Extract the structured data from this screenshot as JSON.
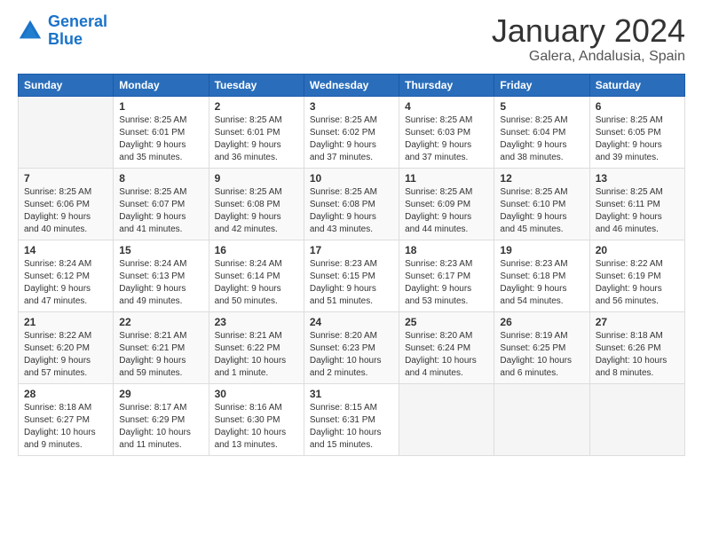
{
  "header": {
    "logo_line1": "General",
    "logo_line2": "Blue",
    "title": "January 2024",
    "subtitle": "Galera, Andalusia, Spain"
  },
  "days_of_week": [
    "Sunday",
    "Monday",
    "Tuesday",
    "Wednesday",
    "Thursday",
    "Friday",
    "Saturday"
  ],
  "weeks": [
    [
      {
        "day": "",
        "content": ""
      },
      {
        "day": "1",
        "content": "Sunrise: 8:25 AM\nSunset: 6:01 PM\nDaylight: 9 hours\nand 35 minutes."
      },
      {
        "day": "2",
        "content": "Sunrise: 8:25 AM\nSunset: 6:01 PM\nDaylight: 9 hours\nand 36 minutes."
      },
      {
        "day": "3",
        "content": "Sunrise: 8:25 AM\nSunset: 6:02 PM\nDaylight: 9 hours\nand 37 minutes."
      },
      {
        "day": "4",
        "content": "Sunrise: 8:25 AM\nSunset: 6:03 PM\nDaylight: 9 hours\nand 37 minutes."
      },
      {
        "day": "5",
        "content": "Sunrise: 8:25 AM\nSunset: 6:04 PM\nDaylight: 9 hours\nand 38 minutes."
      },
      {
        "day": "6",
        "content": "Sunrise: 8:25 AM\nSunset: 6:05 PM\nDaylight: 9 hours\nand 39 minutes."
      }
    ],
    [
      {
        "day": "7",
        "content": "Sunrise: 8:25 AM\nSunset: 6:06 PM\nDaylight: 9 hours\nand 40 minutes."
      },
      {
        "day": "8",
        "content": "Sunrise: 8:25 AM\nSunset: 6:07 PM\nDaylight: 9 hours\nand 41 minutes."
      },
      {
        "day": "9",
        "content": "Sunrise: 8:25 AM\nSunset: 6:08 PM\nDaylight: 9 hours\nand 42 minutes."
      },
      {
        "day": "10",
        "content": "Sunrise: 8:25 AM\nSunset: 6:08 PM\nDaylight: 9 hours\nand 43 minutes."
      },
      {
        "day": "11",
        "content": "Sunrise: 8:25 AM\nSunset: 6:09 PM\nDaylight: 9 hours\nand 44 minutes."
      },
      {
        "day": "12",
        "content": "Sunrise: 8:25 AM\nSunset: 6:10 PM\nDaylight: 9 hours\nand 45 minutes."
      },
      {
        "day": "13",
        "content": "Sunrise: 8:25 AM\nSunset: 6:11 PM\nDaylight: 9 hours\nand 46 minutes."
      }
    ],
    [
      {
        "day": "14",
        "content": "Sunrise: 8:24 AM\nSunset: 6:12 PM\nDaylight: 9 hours\nand 47 minutes."
      },
      {
        "day": "15",
        "content": "Sunrise: 8:24 AM\nSunset: 6:13 PM\nDaylight: 9 hours\nand 49 minutes."
      },
      {
        "day": "16",
        "content": "Sunrise: 8:24 AM\nSunset: 6:14 PM\nDaylight: 9 hours\nand 50 minutes."
      },
      {
        "day": "17",
        "content": "Sunrise: 8:23 AM\nSunset: 6:15 PM\nDaylight: 9 hours\nand 51 minutes."
      },
      {
        "day": "18",
        "content": "Sunrise: 8:23 AM\nSunset: 6:17 PM\nDaylight: 9 hours\nand 53 minutes."
      },
      {
        "day": "19",
        "content": "Sunrise: 8:23 AM\nSunset: 6:18 PM\nDaylight: 9 hours\nand 54 minutes."
      },
      {
        "day": "20",
        "content": "Sunrise: 8:22 AM\nSunset: 6:19 PM\nDaylight: 9 hours\nand 56 minutes."
      }
    ],
    [
      {
        "day": "21",
        "content": "Sunrise: 8:22 AM\nSunset: 6:20 PM\nDaylight: 9 hours\nand 57 minutes."
      },
      {
        "day": "22",
        "content": "Sunrise: 8:21 AM\nSunset: 6:21 PM\nDaylight: 9 hours\nand 59 minutes."
      },
      {
        "day": "23",
        "content": "Sunrise: 8:21 AM\nSunset: 6:22 PM\nDaylight: 10 hours\nand 1 minute."
      },
      {
        "day": "24",
        "content": "Sunrise: 8:20 AM\nSunset: 6:23 PM\nDaylight: 10 hours\nand 2 minutes."
      },
      {
        "day": "25",
        "content": "Sunrise: 8:20 AM\nSunset: 6:24 PM\nDaylight: 10 hours\nand 4 minutes."
      },
      {
        "day": "26",
        "content": "Sunrise: 8:19 AM\nSunset: 6:25 PM\nDaylight: 10 hours\nand 6 minutes."
      },
      {
        "day": "27",
        "content": "Sunrise: 8:18 AM\nSunset: 6:26 PM\nDaylight: 10 hours\nand 8 minutes."
      }
    ],
    [
      {
        "day": "28",
        "content": "Sunrise: 8:18 AM\nSunset: 6:27 PM\nDaylight: 10 hours\nand 9 minutes."
      },
      {
        "day": "29",
        "content": "Sunrise: 8:17 AM\nSunset: 6:29 PM\nDaylight: 10 hours\nand 11 minutes."
      },
      {
        "day": "30",
        "content": "Sunrise: 8:16 AM\nSunset: 6:30 PM\nDaylight: 10 hours\nand 13 minutes."
      },
      {
        "day": "31",
        "content": "Sunrise: 8:15 AM\nSunset: 6:31 PM\nDaylight: 10 hours\nand 15 minutes."
      },
      {
        "day": "",
        "content": ""
      },
      {
        "day": "",
        "content": ""
      },
      {
        "day": "",
        "content": ""
      }
    ]
  ]
}
